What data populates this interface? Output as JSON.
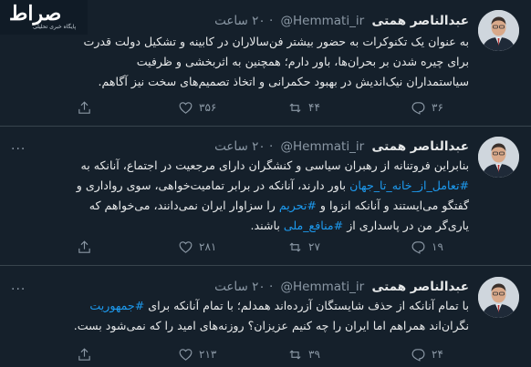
{
  "logo": {
    "main": "صراط",
    "sub": "پایگاه خبری تحلیلی"
  },
  "tweets": [
    {
      "name": "عبدالناصر همتی",
      "handle": "@Hemmati_ir",
      "time": "۲۰ ساعت",
      "lines": [
        "به عنوان یک تکنوکرات به حضور بیشتر فن‌سالاران در کابینه و تشکیل دولت قدرت",
        "برای چیره شدن بر بحران‌ها، باور دارم؛ همچنین به اثربخشی و ظرفیت",
        "سیاستمداران نیک‌اندیش در بهبود حکمرانی و اتخاذ تصمیم‌های سخت نیز آگاهم."
      ],
      "reply_count": "۳۶",
      "retweet_count": "۴۴",
      "like_count": "۳۵۶"
    },
    {
      "name": "عبدالناصر همتی",
      "handle": "@Hemmati_ir",
      "time": "۲۰ ساعت",
      "line1": "بنابراین فروتنانه از رهبران سیاسی و کنشگران دارای مرجعیت در اجتماع، آنانکه به",
      "line2": {
        "hashtag": "#تعامل_از_خانه_تا_جهان",
        "text": " باور دارند، آنانکه در برابر تمامیت‌خواهی، سوی رواداری و"
      },
      "line3": {
        "pre": "گفتگو می‌ایستند و آنانکه انزوا و ",
        "hashtag": "#تحریم",
        "post": " را سزاوار ایران نمی‌دانند، می‌خواهم که"
      },
      "line4": {
        "pre": "یاری‌گر من در پاسداری از ",
        "hashtag": "#منافع_ملی",
        "post": " باشند."
      },
      "reply_count": "۱۹",
      "retweet_count": "۲۷",
      "like_count": "۲۸۱"
    },
    {
      "name": "عبدالناصر همتی",
      "handle": "@Hemmati_ir",
      "time": "۲۰ ساعت",
      "line1": {
        "pre": "با تمام آنانکه از حذف شایستگان آزرده‌اند همدلم؛ با تمام آنانکه برای ",
        "hashtag": "#جمهوریت"
      },
      "line2": "نگران‌اند همراهم اما ایران را چه کنیم عزیزان؟ روزنه‌های امید را که نمی‌شود بست.",
      "reply_count": "۲۴",
      "retweet_count": "۳۹",
      "like_count": "۲۱۳"
    }
  ],
  "icons": {
    "reply": "reply-icon",
    "retweet": "retweet-icon",
    "like": "heart-icon",
    "share": "share-icon",
    "more": "more-icon"
  },
  "colors": {
    "background": "#15202b",
    "text": "#e7e9ea",
    "muted": "#8b98a5",
    "hashtag": "#1d9bf0",
    "divider": "#38444d"
  }
}
